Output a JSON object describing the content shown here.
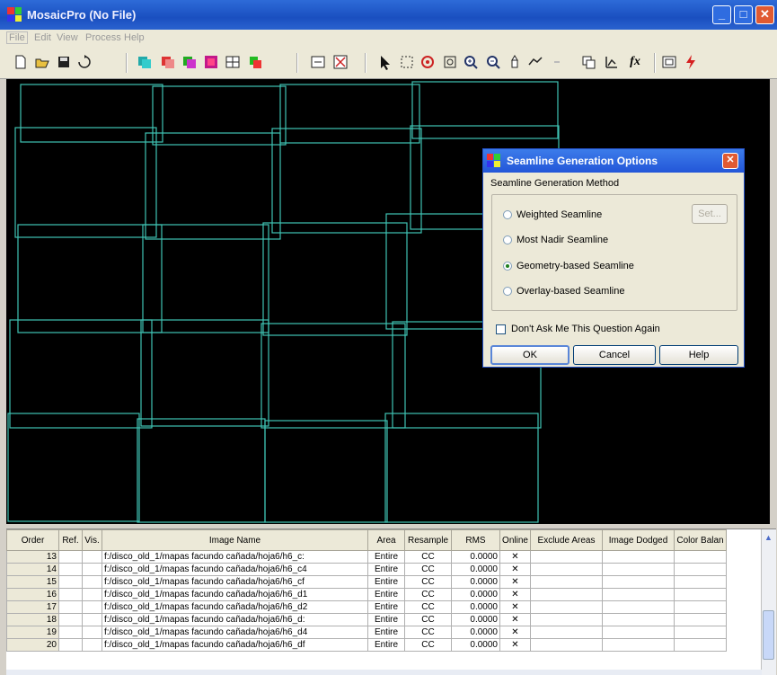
{
  "window": {
    "title": "MosaicPro (No File)",
    "minimize": "_",
    "maximize": "□",
    "close": "✕"
  },
  "menu": {
    "items": [
      "File",
      "Edit",
      "View",
      "Process",
      "Help"
    ]
  },
  "toolbar": {
    "buttons": [
      "new-icon",
      "open-icon",
      "save-icon",
      "export-icon",
      "image-list-icon",
      "add-images-icon",
      "image-stack-icon",
      "color-correction-icon",
      "grid-icon",
      "layers-icon",
      "window-icon",
      "clear-icon",
      "select-arrow-icon",
      "rectangle-select-icon",
      "target-icon",
      "fit-icon",
      "zoom-in-icon",
      "zoom-out-icon",
      "pan-icon",
      "draw-icon",
      "undo-icon",
      "properties-icon",
      "chart-icon",
      "function-icon",
      "output-icon",
      "run-icon"
    ],
    "function_label": "fx",
    "output_colors": {
      "accent": "#d62020"
    }
  },
  "colors": {
    "footprint_stroke": "#3fc3b3",
    "canvas_bg": "#000000",
    "title_bar": "#1a4fc0"
  },
  "dialog": {
    "title": "Seamline Generation Options",
    "group_label": "Seamline Generation Method",
    "options": [
      {
        "label": "Weighted Seamline",
        "selected": false
      },
      {
        "label": "Most Nadir Seamline",
        "selected": false
      },
      {
        "label": "Geometry-based Seamline",
        "selected": true
      },
      {
        "label": "Overlay-based Seamline",
        "selected": false
      }
    ],
    "set_button": "Set...",
    "checkbox_label": "Don't Ask Me This Question Again",
    "checkbox_checked": false,
    "ok": "OK",
    "cancel": "Cancel",
    "help": "Help"
  },
  "table": {
    "columns": [
      "Order",
      "Ref.",
      "Vis.",
      "Image Name",
      "Area",
      "Resample",
      "RMS",
      "Online",
      "Exclude Areas",
      "Image Dodged",
      "Color Balan"
    ],
    "rows": [
      {
        "order": "13",
        "name": "f:/disco_old_1/mapas facundo cañada/hoja6/h6_c:",
        "area": "Entire",
        "resample": "CC",
        "rms": "0.0000",
        "online": "✕"
      },
      {
        "order": "14",
        "name": "f:/disco_old_1/mapas facundo cañada/hoja6/h6_c4",
        "area": "Entire",
        "resample": "CC",
        "rms": "0.0000",
        "online": "✕"
      },
      {
        "order": "15",
        "name": "f:/disco_old_1/mapas facundo cañada/hoja6/h6_cf",
        "area": "Entire",
        "resample": "CC",
        "rms": "0.0000",
        "online": "✕"
      },
      {
        "order": "16",
        "name": "f:/disco_old_1/mapas facundo cañada/hoja6/h6_d1",
        "area": "Entire",
        "resample": "CC",
        "rms": "0.0000",
        "online": "✕"
      },
      {
        "order": "17",
        "name": "f:/disco_old_1/mapas facundo cañada/hoja6/h6_d2",
        "area": "Entire",
        "resample": "CC",
        "rms": "0.0000",
        "online": "✕"
      },
      {
        "order": "18",
        "name": "f:/disco_old_1/mapas facundo cañada/hoja6/h6_d:",
        "area": "Entire",
        "resample": "CC",
        "rms": "0.0000",
        "online": "✕"
      },
      {
        "order": "19",
        "name": "f:/disco_old_1/mapas facundo cañada/hoja6/h6_d4",
        "area": "Entire",
        "resample": "CC",
        "rms": "0.0000",
        "online": "✕"
      },
      {
        "order": "20",
        "name": "f:/disco_old_1/mapas facundo cañada/hoja6/h6_df",
        "area": "Entire",
        "resample": "CC",
        "rms": "0.0000",
        "online": "✕"
      }
    ]
  }
}
